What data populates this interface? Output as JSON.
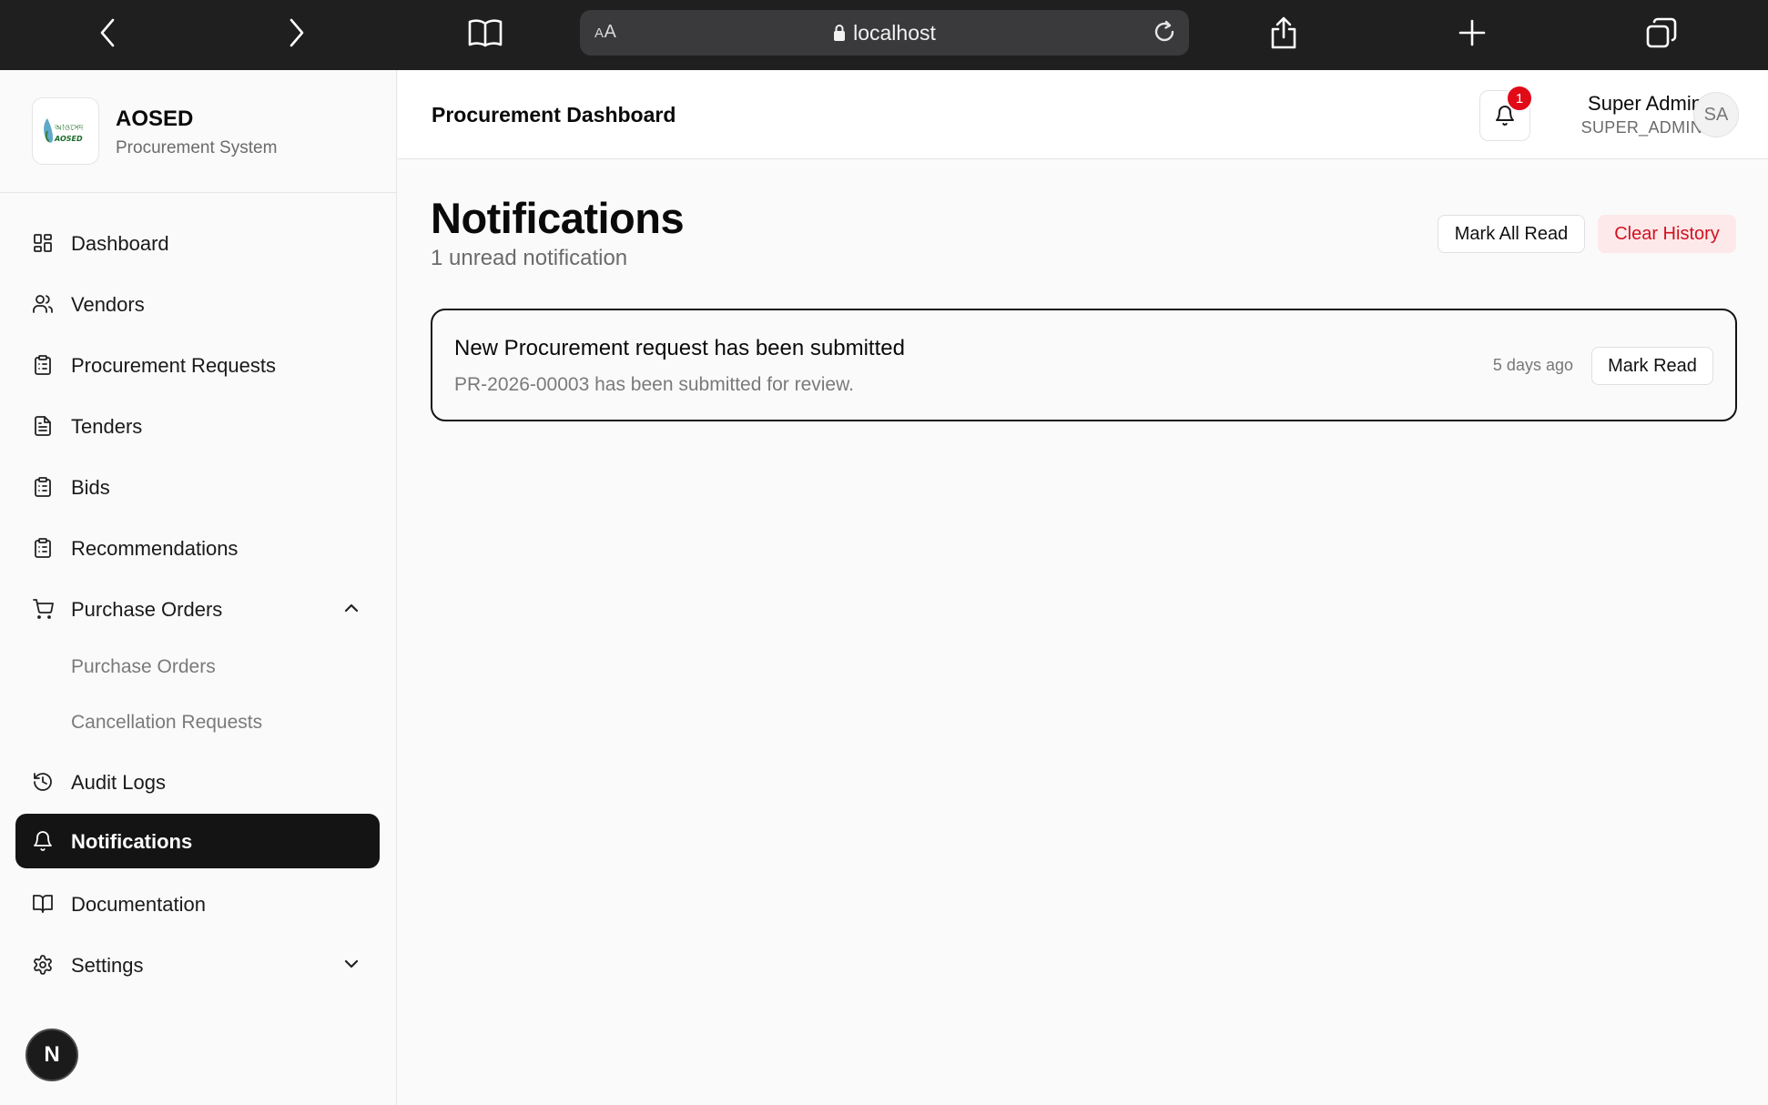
{
  "browser": {
    "aa_label_small": "A",
    "aa_label": "A",
    "url": "localhost"
  },
  "brand": {
    "title": "AOSED",
    "subtitle": "Procurement System"
  },
  "sidebar": {
    "items": [
      {
        "label": "Dashboard",
        "icon": "layout-grid-icon"
      },
      {
        "label": "Vendors",
        "icon": "users-icon"
      },
      {
        "label": "Procurement Requests",
        "icon": "clipboard-list-icon"
      },
      {
        "label": "Tenders",
        "icon": "file-text-icon"
      },
      {
        "label": "Bids",
        "icon": "clipboard-list-icon"
      },
      {
        "label": "Recommendations",
        "icon": "clipboard-list-icon"
      },
      {
        "label": "Purchase Orders",
        "icon": "shopping-cart-icon",
        "expanded": true
      },
      {
        "label": "Audit Logs",
        "icon": "history-icon"
      },
      {
        "label": "Notifications",
        "icon": "bell-icon",
        "active": true
      },
      {
        "label": "Documentation",
        "icon": "book-open-icon"
      },
      {
        "label": "Settings",
        "icon": "gear-icon",
        "expanded": false
      }
    ],
    "purchase_orders_sub": [
      "Purchase Orders",
      "Cancellation Requests"
    ],
    "dev_badge": "N"
  },
  "header": {
    "title": "Procurement Dashboard",
    "notification_count": "1",
    "user_name": "Super Admin",
    "user_role": "SUPER_ADMIN",
    "avatar_initials": "SA"
  },
  "main": {
    "title": "Notifications",
    "subtitle": "1 unread notification",
    "mark_all_read": "Mark All Read",
    "clear_history": "Clear History",
    "notifications": [
      {
        "title": "New Procurement request has been submitted",
        "body": "PR-2026-00003 has been submitted for review.",
        "time": "5 days ago",
        "action": "Mark Read"
      }
    ]
  },
  "colors": {
    "active_nav_bg": "#141414",
    "danger": "#d0121f",
    "danger_bg": "#fde8ea",
    "badge_red": "#e00b16",
    "browser_bar": "#1f1f1f"
  }
}
